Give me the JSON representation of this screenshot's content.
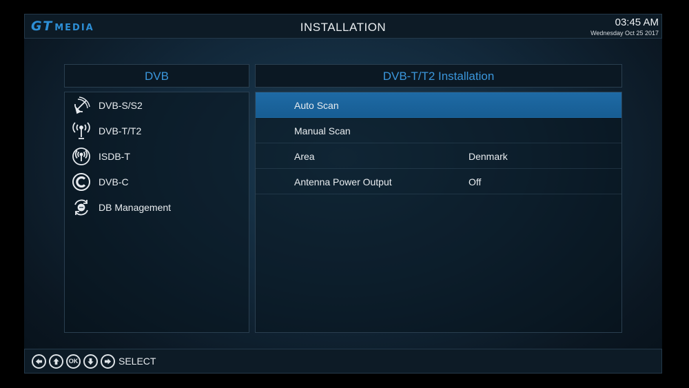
{
  "header": {
    "logo_gt": "GT",
    "logo_media": "MEDIA",
    "title": "INSTALLATION",
    "time": "03:45  AM",
    "date": "Wednesday  Oct 25 2017"
  },
  "left_panel": {
    "title": "DVB",
    "items": [
      {
        "label": "DVB-S/S2",
        "icon": "satellite-dish-icon"
      },
      {
        "label": "DVB-T/T2",
        "icon": "antenna-icon"
      },
      {
        "label": "ISDB-T",
        "icon": "broadcast-icon"
      },
      {
        "label": "DVB-C",
        "icon": "cable-c-icon"
      },
      {
        "label": "DB Management",
        "icon": "database-sync-icon"
      }
    ]
  },
  "right_panel": {
    "title": "DVB-T/T2 Installation",
    "rows": [
      {
        "label": "Auto Scan",
        "value": "",
        "selected": true
      },
      {
        "label": "Manual Scan",
        "value": ""
      },
      {
        "label": "Area",
        "value": "Denmark"
      },
      {
        "label": "Antenna Power Output",
        "value": "Off"
      }
    ]
  },
  "footer": {
    "ok_label": "OK",
    "select_label": "SELECT"
  },
  "colors": {
    "accent": "#3b97dc",
    "selected_row": "#1e6aa5",
    "background": "#12283a"
  }
}
